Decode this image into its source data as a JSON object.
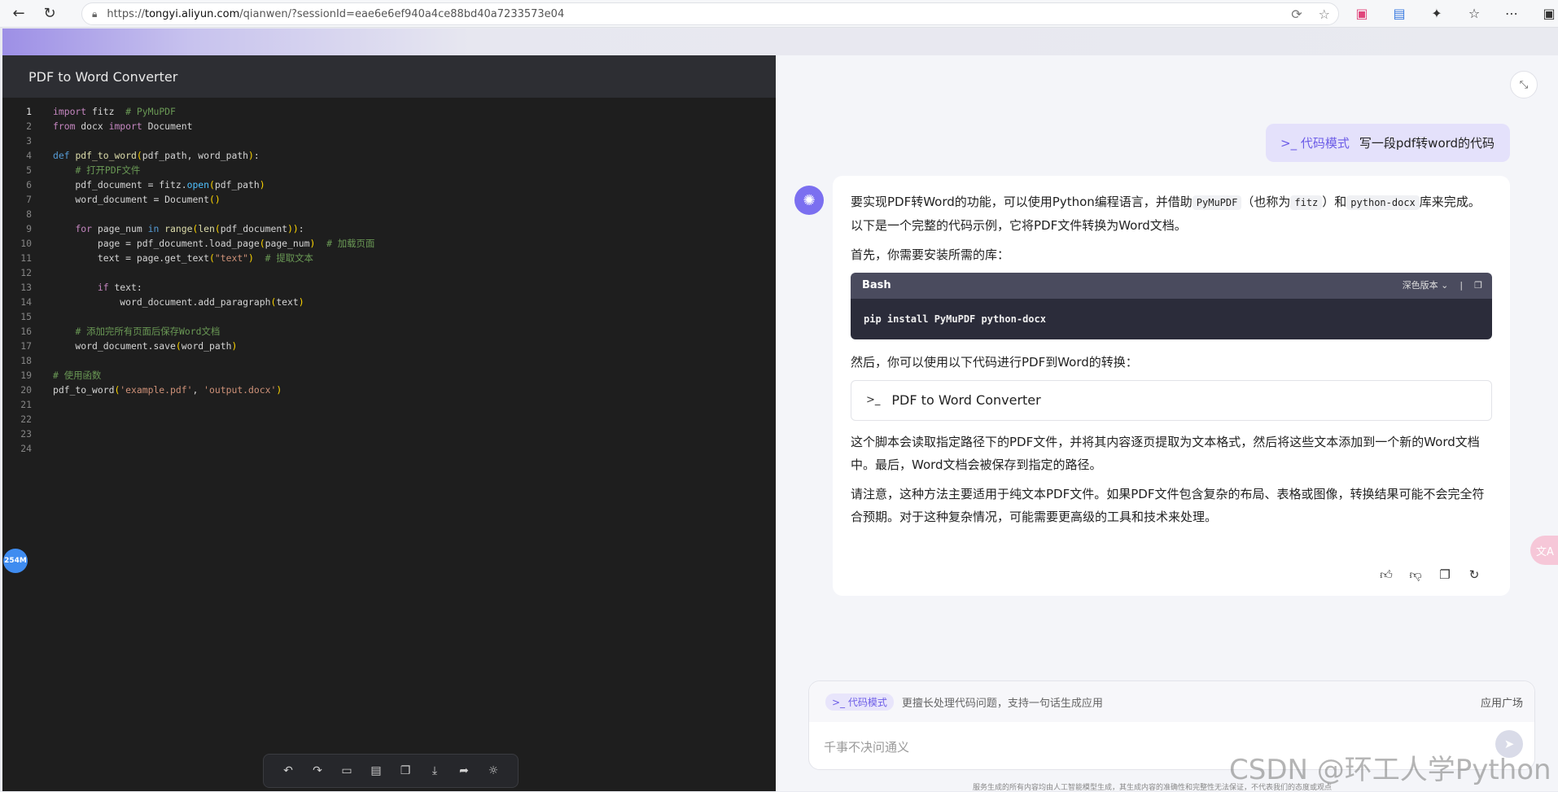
{
  "browser": {
    "url_prefix": "https://",
    "url_host": "tongyi.aliyun.com",
    "url_path": "/qianwen/?sessionId=eae6e6ef940a4ce88bd40a7233573e04"
  },
  "code_panel": {
    "title": "PDF to Word Converter",
    "lines": [
      "1",
      "2",
      "3",
      "4",
      "5",
      "6",
      "7",
      "8",
      "9",
      "10",
      "11",
      "12",
      "13",
      "14",
      "15",
      "16",
      "17",
      "18",
      "19",
      "20",
      "21",
      "22",
      "23",
      "24"
    ],
    "memory_badge": "254M"
  },
  "chat": {
    "user_message": {
      "mode": "代码模式",
      "text": "写一段pdf转word的代码"
    },
    "answer": {
      "p1_a": "要实现PDF转Word的功能，可以使用Python编程语言，并借助",
      "p1_code1": "PyMuPDF",
      "p1_b": "（也称为",
      "p1_code2": "fitz",
      "p1_c": "）和",
      "p1_code3": "python-docx",
      "p1_d": "库来完成。以下是一个完整的代码示例，它将PDF文件转换为Word文档。",
      "p2": "首先，你需要安装所需的库：",
      "bash_lang": "Bash",
      "bash_theme": "深色版本",
      "bash_code": "pip install PyMuPDF python-docx",
      "p3": "然后，你可以使用以下代码进行PDF到Word的转换：",
      "artifact_title": "PDF to Word Converter",
      "p4": "这个脚本会读取指定路径下的PDF文件，并将其内容逐页提取为文本格式，然后将这些文本添加到一个新的Word文档中。最后，Word文档会被保存到指定的路径。",
      "p5": "请注意，这种方法主要适用于纯文本PDF文件。如果PDF文件包含复杂的布局、表格或图像，转换结果可能不会完全符合预期。对于这种复杂情况，可能需要更高级的工具和技术来处理。"
    },
    "input": {
      "mode_pill": "代码模式",
      "hint": "更擅长处理代码问题，支持一句话生成应用",
      "app_square": "应用广场",
      "placeholder": "千事不决问通义"
    },
    "disclaimer": "服务生成的所有内容均由人工智能模型生成，其生成内容的准确性和完整性无法保证，不代表我们的态度或观点",
    "watermark": "CSDN @环工人学Python"
  }
}
